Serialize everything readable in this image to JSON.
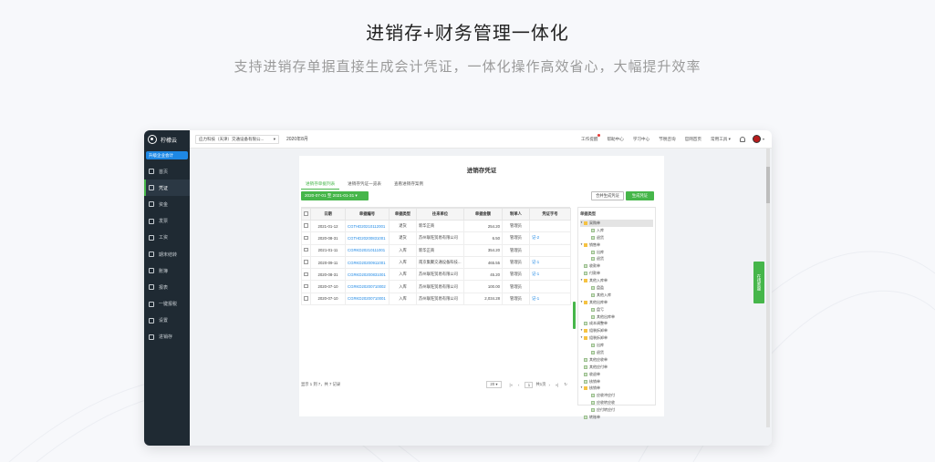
{
  "hero": {
    "title": "进销存+财务管理一体化",
    "subtitle": "支持进销存单据直接生成会计凭证，一体化操作高效省心，大幅提升效率"
  },
  "app": {
    "logo_text": "柠檬云",
    "badge": "升级企业会计",
    "sidebar": [
      {
        "label": "首页",
        "icon": "home-icon"
      },
      {
        "label": "凭证",
        "icon": "voucher-icon",
        "active": true
      },
      {
        "label": "资金",
        "icon": "money-icon"
      },
      {
        "label": "发票",
        "icon": "invoice-icon"
      },
      {
        "label": "工资",
        "icon": "salary-icon"
      },
      {
        "label": "期末结转",
        "icon": "closing-icon"
      },
      {
        "label": "账簿",
        "icon": "ledger-icon"
      },
      {
        "label": "报表",
        "icon": "report-icon"
      },
      {
        "label": "一键报税",
        "icon": "tax-icon"
      },
      {
        "label": "设置",
        "icon": "gear-icon"
      },
      {
        "label": "进销存",
        "icon": "inventory-icon"
      }
    ],
    "topbar": {
      "company": "应力科技（天津）交通设备有限公...",
      "period": "2020年8月",
      "links": [
        "工作提醒",
        "帮助中心",
        "学习中心",
        "节税咨询",
        "官网首页",
        "常用工具"
      ]
    },
    "panel": {
      "title": "进销存凭证",
      "tabs": [
        "进销存单据列表",
        "进销存凭证一览表",
        "查看进销存案例"
      ],
      "date_range": "2020-07-01 至 2021-01-31",
      "btn_merge": "合并生成凭证",
      "btn_generate": "生成凭证",
      "table": {
        "headers": [
          "",
          "日期",
          "单据编号",
          "单据类型",
          "往来单位",
          "单据金额",
          "制单人",
          "凭证字号"
        ],
        "rows": [
          [
            "",
            "2021-01-12",
            "CGTHD20210112001",
            "退货",
            "新华正商",
            "254.20",
            "管理员",
            ""
          ],
          [
            "",
            "2020-08-31",
            "CGTHD20200831001",
            "退货",
            "苏州联旺贸易有限公司",
            "6.50",
            "管理员",
            "记-2"
          ],
          [
            "",
            "2021-01-11",
            "CGRKD20210111001",
            "入库",
            "新华正商",
            "354.20",
            "管理员",
            ""
          ],
          [
            "",
            "2020-09-11",
            "CGRKD20200911001",
            "入库",
            "南京集聚交通设备科技...",
            "465.55",
            "管理员",
            "记-1"
          ],
          [
            "",
            "2020-08-31",
            "CGRKD20200831001",
            "入库",
            "苏州联旺贸易有限公司",
            "45.20",
            "管理员",
            "记-1"
          ],
          [
            "",
            "2020-07-10",
            "CGRKD20200710002",
            "入库",
            "苏州联旺贸易有限公司",
            "100.00",
            "管理员",
            ""
          ],
          [
            "",
            "2020-07-10",
            "CGRKD20200710001",
            "入库",
            "苏州联旺贸易有限公司",
            "2,034.28",
            "管理员",
            "记-1"
          ]
        ]
      },
      "pager": {
        "summary": "显示 1 到 7，共 7 记录",
        "page_size": "20",
        "page": "1",
        "total_pages": "共1页"
      },
      "tree": {
        "title": "单据类型",
        "nodes": [
          {
            "label": "采购单",
            "type": "folder",
            "level": 0,
            "selected": true
          },
          {
            "label": "入库",
            "type": "file",
            "level": 1
          },
          {
            "label": "退货",
            "type": "file",
            "level": 1
          },
          {
            "label": "销售单",
            "type": "folder",
            "level": 0
          },
          {
            "label": "出库",
            "type": "file",
            "level": 1
          },
          {
            "label": "退货",
            "type": "file",
            "level": 1
          },
          {
            "label": "收款单",
            "type": "file",
            "level": 0
          },
          {
            "label": "付款单",
            "type": "file",
            "level": 0
          },
          {
            "label": "其他入库单",
            "type": "folder",
            "level": 0
          },
          {
            "label": "盘盈",
            "type": "file",
            "level": 1
          },
          {
            "label": "其他入库",
            "type": "file",
            "level": 1
          },
          {
            "label": "其他出库单",
            "type": "folder",
            "level": 0
          },
          {
            "label": "盘亏",
            "type": "file",
            "level": 1
          },
          {
            "label": "其他出库单",
            "type": "file",
            "level": 1
          },
          {
            "label": "成本调整单",
            "type": "file",
            "level": 0
          },
          {
            "label": "组装拆卸单",
            "type": "folder",
            "level": 0
          },
          {
            "label": "组装拆卸单",
            "type": "folder",
            "level": 0
          },
          {
            "label": "出库",
            "type": "file",
            "level": 1
          },
          {
            "label": "退货",
            "type": "file",
            "level": 1
          },
          {
            "label": "其他应收单",
            "type": "file",
            "level": 0
          },
          {
            "label": "其他应付单",
            "type": "file",
            "level": 0
          },
          {
            "label": "收退单",
            "type": "file",
            "level": 0
          },
          {
            "label": "核销单",
            "type": "file",
            "level": 0
          },
          {
            "label": "核销单",
            "type": "folder",
            "level": 0
          },
          {
            "label": "应收冲应付",
            "type": "file",
            "level": 1
          },
          {
            "label": "应收转应收",
            "type": "file",
            "level": 1
          },
          {
            "label": "应付转应付",
            "type": "file",
            "level": 1
          },
          {
            "label": "转账单",
            "type": "file",
            "level": 0
          }
        ]
      }
    },
    "float_tab": "在线客服"
  }
}
